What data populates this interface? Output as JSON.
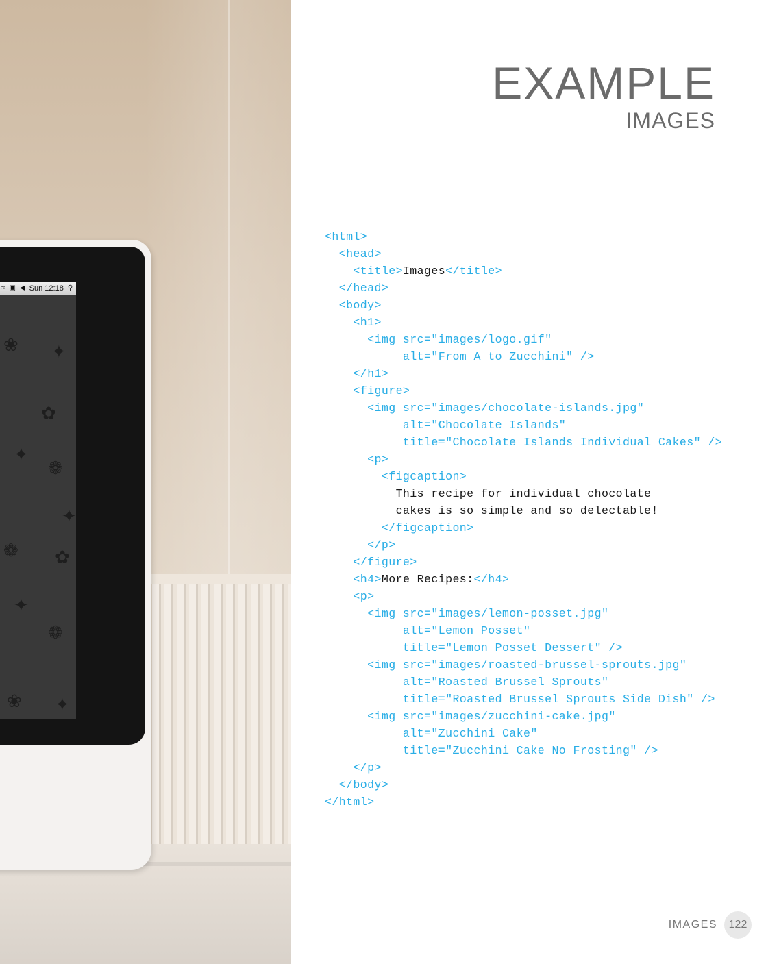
{
  "heading": {
    "title": "EXAMPLE",
    "subtitle": "IMAGES"
  },
  "menubar": {
    "time": "Sun 12:18",
    "icons": [
      "wifi-icon",
      "keyboard-icon",
      "volume-icon",
      "search-icon"
    ]
  },
  "code": [
    [
      {
        "t": "<html>"
      }
    ],
    [
      {
        "t": "  <head>"
      }
    ],
    [
      {
        "t": "    <title>"
      },
      {
        "x": "Images"
      },
      {
        "t": "</title>"
      }
    ],
    [
      {
        "t": "  </head>"
      }
    ],
    [
      {
        "t": "  <body>"
      }
    ],
    [
      {
        "t": "    <h1>"
      }
    ],
    [
      {
        "t": "      <img src=\"images/logo.gif\""
      }
    ],
    [
      {
        "t": "           alt=\"From A to Zucchini\" />"
      }
    ],
    [
      {
        "t": "    </h1>"
      }
    ],
    [
      {
        "t": "    <figure>"
      }
    ],
    [
      {
        "t": "      <img src=\"images/chocolate-islands.jpg\""
      }
    ],
    [
      {
        "t": "           alt=\"Chocolate Islands\""
      }
    ],
    [
      {
        "t": "           title=\"Chocolate Islands Individual Cakes\" />"
      }
    ],
    [
      {
        "t": "      <p>"
      }
    ],
    [
      {
        "t": "        <figcaption>"
      }
    ],
    [
      {
        "x": "          This recipe for individual chocolate"
      }
    ],
    [
      {
        "x": "          cakes is so simple and so delectable!"
      }
    ],
    [
      {
        "t": "        </figcaption>"
      }
    ],
    [
      {
        "t": "      </p>"
      }
    ],
    [
      {
        "t": "    </figure>"
      }
    ],
    [
      {
        "t": "    <h4>"
      },
      {
        "x": "More Recipes:"
      },
      {
        "t": "</h4>"
      }
    ],
    [
      {
        "t": "    <p>"
      }
    ],
    [
      {
        "t": "      <img src=\"images/lemon-posset.jpg\""
      }
    ],
    [
      {
        "t": "           alt=\"Lemon Posset\""
      }
    ],
    [
      {
        "t": "           title=\"Lemon Posset Dessert\" />"
      }
    ],
    [
      {
        "t": "      <img src=\"images/roasted-brussel-sprouts.jpg\""
      }
    ],
    [
      {
        "t": "           alt=\"Roasted Brussel Sprouts\""
      }
    ],
    [
      {
        "t": "           title=\"Roasted Brussel Sprouts Side Dish\" />"
      }
    ],
    [
      {
        "t": "      <img src=\"images/zucchini-cake.jpg\""
      }
    ],
    [
      {
        "t": "           alt=\"Zucchini Cake\""
      }
    ],
    [
      {
        "t": "           title=\"Zucchini Cake No Frosting\" />"
      }
    ],
    [
      {
        "t": "    </p>"
      }
    ],
    [
      {
        "t": "  </body>"
      }
    ],
    [
      {
        "t": "</html>"
      }
    ]
  ],
  "footer": {
    "section": "IMAGES",
    "page": "122"
  },
  "colors": {
    "tag": "#2aaee6",
    "text": "#1a1a1a",
    "heading": "#6b6b6b"
  }
}
